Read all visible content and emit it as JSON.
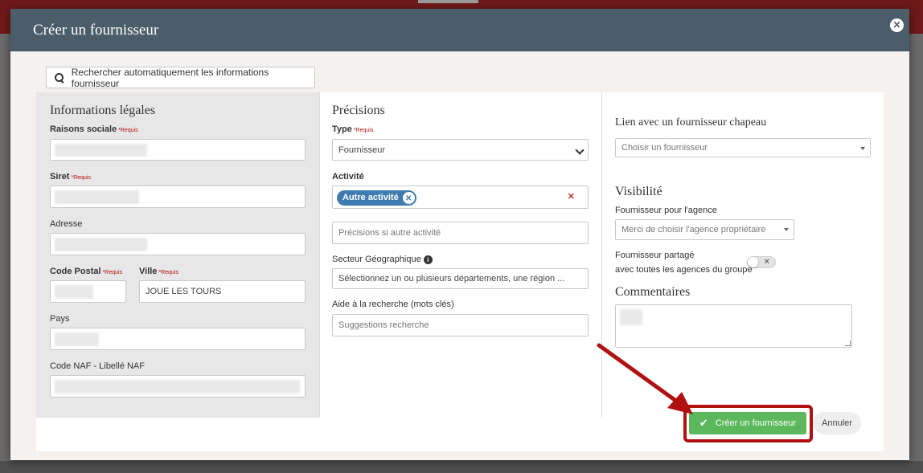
{
  "modal": {
    "title": "Créer un fournisseur",
    "close_icon": "close-icon",
    "search_button_label": "Rechercher automatiquement les informations fournisseur"
  },
  "legal": {
    "title": "Informations légales",
    "company_name_label": "Raisons sociale",
    "siret_label": "Siret",
    "address_label": "Adresse",
    "postal_code_label": "Code Postal",
    "city_label": "Ville",
    "city_value": "JOUE LES TOURS",
    "country_label": "Pays",
    "naf_label": "Code NAF - Libellé NAF",
    "required_marker": "*Requis"
  },
  "details": {
    "title": "Précisions",
    "type_label": "Type",
    "type_value": "Fournisseur",
    "activity_label": "Activité",
    "activity_tag": "Autre activité",
    "activity_other_placeholder": "Précisions si autre activité",
    "sector_label": "Secteur Géographique",
    "sector_placeholder": "Sélectionnez un ou plusieurs départements, une région ...",
    "keywords_label": "Aide à la recherche (mots clés)",
    "keywords_placeholder": "Suggestions recherche"
  },
  "right": {
    "parent_title": "Lien avec un fournisseur chapeau",
    "parent_placeholder": "Choisir un fournisseur",
    "visibility_title": "Visibilité",
    "agency_label": "Fournisseur pour l'agence",
    "agency_placeholder": "Merci de choisir l'agence propriétaire",
    "shared_label_line1": "Fournisseur partagé",
    "shared_label_line2": "avec toutes les agences du groupe",
    "comments_title": "Commentaires"
  },
  "footer": {
    "create_label": "Créer un fournisseur",
    "cancel_label": "Annuler"
  },
  "colors": {
    "header": "#4a5d68",
    "primary_button": "#5cb85c",
    "highlight": "#b01010",
    "tag": "#3e7cb0"
  }
}
